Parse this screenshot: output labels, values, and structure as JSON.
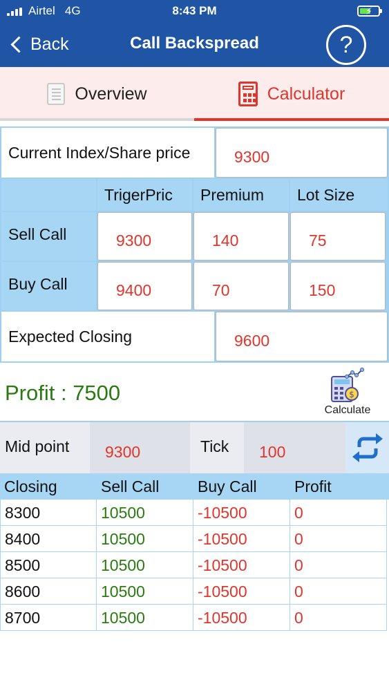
{
  "status": {
    "carrier": "Airtel",
    "network": "4G",
    "time": "8:43 PM"
  },
  "nav": {
    "back_label": "Back",
    "title": "Call Backspread",
    "help_label": "?"
  },
  "tabs": [
    {
      "label": "Overview"
    },
    {
      "label": "Calculator"
    }
  ],
  "form": {
    "current_price_label": "Current Index/Share price",
    "current_price_value": "9300",
    "headers": [
      "TrigerPric",
      "Premium",
      "Lot Size"
    ],
    "sell_call": {
      "label": "Sell Call",
      "trigger": "9300",
      "premium": "140",
      "lot": "75"
    },
    "buy_call": {
      "label": "Buy Call",
      "trigger": "9400",
      "premium": "70",
      "lot": "150"
    },
    "expected_label": "Expected Closing",
    "expected_value": "9600"
  },
  "profit": {
    "text": "Profit : 7500",
    "calculate_label": "Calculate"
  },
  "mid": {
    "mid_label": "Mid point",
    "mid_value": "9300",
    "tick_label": "Tick",
    "tick_value": "100"
  },
  "table": {
    "headers": [
      "Closing",
      "Sell Call",
      "Buy Call",
      "Profit"
    ],
    "rows": [
      [
        "8300",
        "10500",
        "-10500",
        "0"
      ],
      [
        "8400",
        "10500",
        "-10500",
        "0"
      ],
      [
        "8500",
        "10500",
        "-10500",
        "0"
      ],
      [
        "8600",
        "10500",
        "-10500",
        "0"
      ],
      [
        "8700",
        "10500",
        "-10500",
        "0"
      ]
    ]
  },
  "colors": {
    "nav": "#1f55a4",
    "accent": "#e1352c",
    "profit_green": "#2a7a12",
    "grid_blue": "#a7d6f5"
  }
}
